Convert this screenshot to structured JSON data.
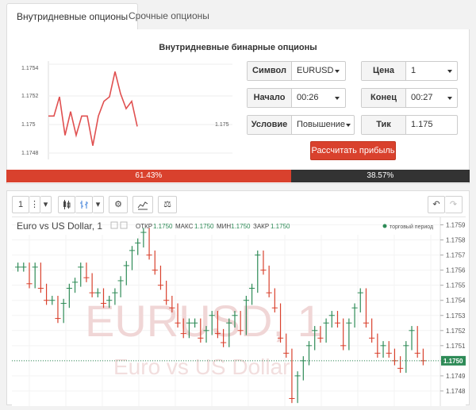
{
  "tabs": [
    {
      "label": "Внутридневные опционы",
      "active": true
    },
    {
      "label": "Срочные опционы",
      "active": false
    }
  ],
  "panel": {
    "title": "Внутридневные бинарные опционы",
    "mini_chart": {
      "y_ticks": [
        "1.1754",
        "1.1752",
        "1.175",
        "1.1748"
      ],
      "right_label": "1.175",
      "values": [
        1.17505,
        1.17505,
        1.17518,
        1.17492,
        1.17508,
        1.17492,
        1.17505,
        1.17505,
        1.17485,
        1.17505,
        1.17515,
        1.17518,
        1.17535,
        1.1752,
        1.1751,
        1.17515,
        1.17498
      ]
    },
    "fields": {
      "symbol": {
        "label": "Символ",
        "value": "EURUSD"
      },
      "price": {
        "label": "Цена",
        "value": "1"
      },
      "start": {
        "label": "Начало",
        "value": "00:26"
      },
      "end": {
        "label": "Конец",
        "value": "00:27"
      },
      "condition": {
        "label": "Условие",
        "value": "Повышение"
      },
      "tick": {
        "label": "Тик",
        "value": "1.175"
      }
    },
    "calc_button": "Рассчитать прибыль"
  },
  "progress": {
    "up_label": "61.43%",
    "down_label": "38.57%",
    "up_fraction": 0.6143,
    "colors": {
      "up": "#d9412d",
      "down": "#333333"
    }
  },
  "chart": {
    "toolbar": {
      "interval": "1"
    },
    "symbol_label": "Euro vs US Dollar, 1",
    "ohlc": {
      "open_label": "ОТКР",
      "open": "1.1750",
      "high_label": "МАКС",
      "high": "1.1750",
      "low_label": "МИН",
      "low": "1.1750",
      "close_label": "ЗАКР",
      "close": "1.1750"
    },
    "session_label": "торговый период",
    "watermark_symbol": "EURUSD, 1",
    "watermark_name": "Euro vs US Dollar",
    "price_labels": [
      "1.1759",
      "1.1758",
      "1.1757",
      "1.1756",
      "1.1755",
      "1.1754",
      "1.1753",
      "1.1752",
      "1.1751",
      "1.1750",
      "1.1749",
      "1.1748"
    ],
    "current_price": "1.1750",
    "colors": {
      "up": "#2e8b57",
      "down": "#d9412d",
      "current": "#2e8b57"
    }
  },
  "chart_data": {
    "type": "line",
    "title": "",
    "xlabel": "",
    "ylabel": "",
    "ylim": [
      1.1747,
      1.17595
    ],
    "series": [
      {
        "values": [
          1.17562,
          1.17562,
          1.17551,
          1.17562,
          1.17548,
          1.1754,
          1.1754,
          1.17528,
          1.17538,
          1.17548,
          1.17552,
          1.17562,
          1.17555,
          1.17545,
          1.17545,
          1.17538,
          1.1754,
          1.17545,
          1.17553,
          1.17563,
          1.17573,
          1.17578,
          1.17585,
          1.1757,
          1.1756,
          1.1755,
          1.1754,
          1.17535,
          1.17525,
          1.17518,
          1.17525,
          1.17525,
          1.17515,
          1.1752,
          1.1753,
          1.17518,
          1.17512,
          1.17525,
          1.1753,
          1.1752,
          1.1754,
          1.17548,
          1.1757,
          1.1756,
          1.17545,
          1.17535,
          1.17515,
          1.17505,
          1.17475,
          1.1749,
          1.175,
          1.1751,
          1.1752,
          1.17515,
          1.17525,
          1.1753,
          1.17525,
          1.1751,
          1.17525,
          1.17535,
          1.17545,
          1.17525,
          1.17515,
          1.17505,
          1.1751,
          1.17505,
          1.175,
          1.17495,
          1.1751,
          1.1752,
          1.17505,
          1.175
        ]
      }
    ]
  }
}
